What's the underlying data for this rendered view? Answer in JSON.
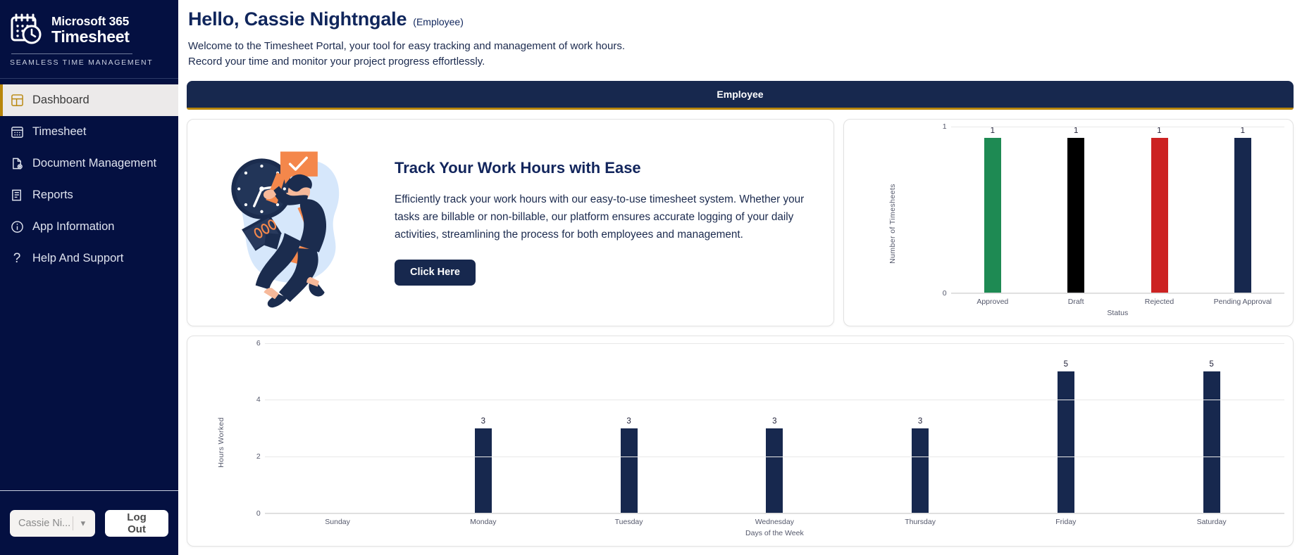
{
  "brand": {
    "line1": "Microsoft 365",
    "line2": "Timesheet",
    "tagline": "SEAMLESS TIME MANAGEMENT"
  },
  "sidebar": {
    "items": [
      {
        "label": "Dashboard",
        "icon": "grid-icon",
        "active": true
      },
      {
        "label": "Timesheet",
        "icon": "calendar-icon",
        "active": false
      },
      {
        "label": "Document Management",
        "icon": "document-gear-icon",
        "active": false
      },
      {
        "label": "Reports",
        "icon": "report-icon",
        "active": false
      },
      {
        "label": "App Information",
        "icon": "info-icon",
        "active": false
      },
      {
        "label": "Help And Support",
        "icon": "question-icon",
        "active": false
      }
    ],
    "user_select_value": "Cassie Ni...",
    "logout_label": "Log Out"
  },
  "header": {
    "greeting": "Hello, Cassie Nightngale",
    "role_suffix": "(Employee)",
    "welcome_line1": "Welcome to the Timesheet Portal, your tool for easy tracking and management of work hours.",
    "welcome_line2": "Record your time and monitor your project progress effortlessly."
  },
  "role_banner": {
    "label": "Employee"
  },
  "hero": {
    "title": "Track Your Work Hours with Ease",
    "body": "Efficiently track your work hours with our easy-to-use timesheet system. Whether your tasks are billable or non-billable, our platform ensures accurate logging of your daily activities, streamlining the process for both employees and management.",
    "cta_label": "Click Here"
  },
  "colors": {
    "sidebar_bg": "#041041",
    "accent_gold": "#b8860b",
    "navy": "#17284e",
    "approved_green": "#1e8a53",
    "draft_black": "#000000",
    "rejected_red": "#cc2222",
    "pending_navy": "#17284e"
  },
  "chart_data": [
    {
      "id": "status-chart",
      "type": "bar",
      "title": "",
      "xlabel": "Status",
      "ylabel": "Number of Timesheets",
      "categories": [
        "Approved",
        "Draft",
        "Rejected",
        "Pending Approval"
      ],
      "values": [
        1,
        1,
        1,
        1
      ],
      "bar_colors": [
        "#1e8a53",
        "#000000",
        "#cc2222",
        "#17284e"
      ],
      "ylim": [
        0,
        1
      ],
      "yticks": [
        0,
        1
      ],
      "grid": true,
      "legend": "none",
      "data_labels": [
        "1",
        "1",
        "1",
        "1"
      ]
    },
    {
      "id": "weekly-hours-chart",
      "type": "bar",
      "title": "",
      "xlabel": "Days of the Week",
      "ylabel": "Hours Worked",
      "categories": [
        "Sunday",
        "Monday",
        "Tuesday",
        "Wednesday",
        "Thursday",
        "Friday",
        "Saturday"
      ],
      "values": [
        0,
        3,
        3,
        3,
        3,
        5,
        5
      ],
      "bar_colors": [
        "#17284e",
        "#17284e",
        "#17284e",
        "#17284e",
        "#17284e",
        "#17284e",
        "#17284e"
      ],
      "ylim": [
        0,
        6
      ],
      "yticks": [
        0,
        2,
        4,
        6
      ],
      "grid": true,
      "legend": "none",
      "data_labels": [
        "",
        "3",
        "3",
        "3",
        "3",
        "5",
        "5"
      ]
    }
  ]
}
